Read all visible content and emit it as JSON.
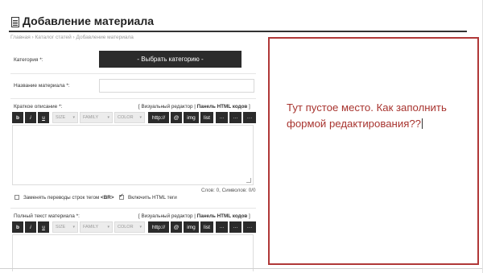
{
  "page": {
    "title": "Добавление материала",
    "breadcrumb": "Главная › Каталог статей › Добавление материала"
  },
  "form": {
    "category_label": "Категория *:",
    "category_button": "- Выбрать категорию -",
    "name_label": "Название материала *:",
    "name_value": "",
    "short_label": "Краткое описание *:",
    "full_label": "Полный текст материала *:",
    "editor_switch_prefix": "[ Визуальный редактор | ",
    "editor_switch_bold": "Панель HTML кодов",
    "editor_switch_suffix": " ]",
    "counter": "Слов: 0, Символов: 0/0",
    "cb_br_prefix": "Заменять переводы строк тегом ",
    "cb_br_tag": "<BR>",
    "cb_br_checked": false,
    "cb_html_label": "Включить HTML теги",
    "cb_html_checked": true
  },
  "toolbar": {
    "bold": "b",
    "italic": "i",
    "underline": "u",
    "size": "SIZE",
    "family": "FAMILY",
    "color": "COLOR",
    "http": "http://",
    "at": "@",
    "img": "img",
    "list": "list",
    "more1": "···",
    "more2": "···",
    "more3": "···"
  },
  "annotation": {
    "text": "Тут пустое место. Как заполнить формой редактирования??",
    "color": "#a8342f"
  }
}
